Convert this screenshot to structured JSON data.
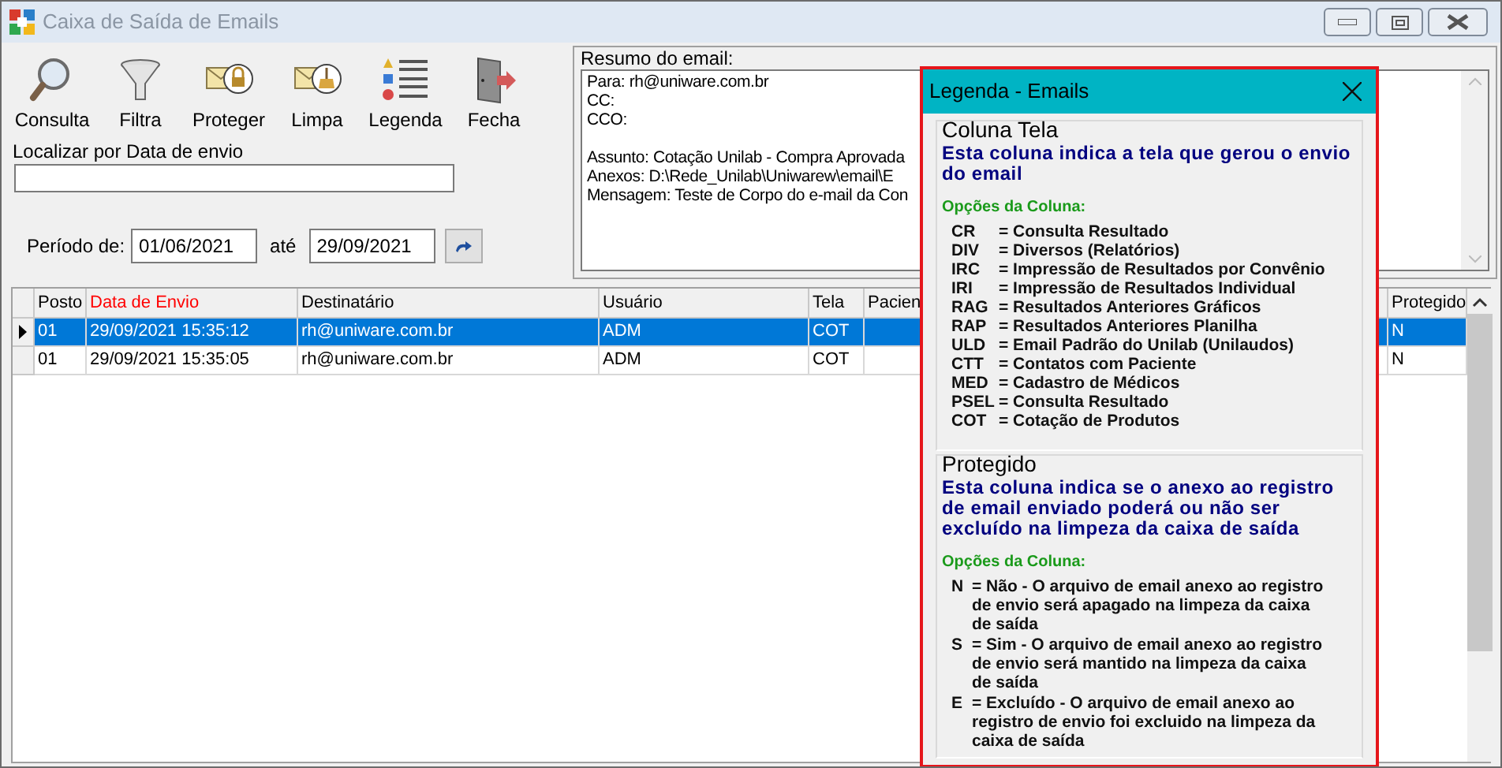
{
  "window": {
    "title": "Caixa de Saída de Emails"
  },
  "toolbar": [
    {
      "kind": "search",
      "label": "Consulta"
    },
    {
      "kind": "filter",
      "label": "Filtra"
    },
    {
      "kind": "lock",
      "label": "Proteger"
    },
    {
      "kind": "broom",
      "label": "Limpa"
    },
    {
      "kind": "list",
      "label": "Legenda"
    },
    {
      "kind": "door",
      "label": "Fecha"
    }
  ],
  "search": {
    "label": "Localizar por Data de envio"
  },
  "period": {
    "label": "Período de:",
    "from": "01/06/2021",
    "to_label": "até",
    "to": "29/09/2021"
  },
  "summary": {
    "label": "Resumo do email:",
    "lines": [
      {
        "text": "Para: rh@uniware.com.br",
        "blank_before": false
      },
      {
        "text": "CC:",
        "blank_before": false
      },
      {
        "text": "CCO:",
        "blank_before": false
      },
      {
        "text": "Assunto: Cotação Unilab - Compra Aprovada",
        "blank_before": true
      },
      {
        "text": "Anexos: D:\\Rede_Unilab\\Uniwarew\\email\\E",
        "blank_before": false
      },
      {
        "text": "Mensagem: Teste de Corpo do e-mail da Con",
        "blank_before": false
      }
    ]
  },
  "table": {
    "columns": [
      {
        "label": "Posto",
        "highlighted": false
      },
      {
        "label": "Data de Envio",
        "highlighted": true
      },
      {
        "label": "Destinatário",
        "highlighted": false
      },
      {
        "label": "Usuário",
        "highlighted": false
      },
      {
        "label": "Tela",
        "highlighted": false
      },
      {
        "label": "Pacien",
        "highlighted": false
      },
      {
        "label": "Protegido",
        "highlighted": false
      }
    ],
    "rows": [
      {
        "selected": true,
        "cells": [
          "01",
          "29/09/2021 15:35:12",
          "rh@uniware.com.br",
          "ADM",
          "COT",
          "",
          "N"
        ]
      },
      {
        "selected": false,
        "cells": [
          "01",
          "29/09/2021 15:35:05",
          "rh@uniware.com.br",
          "ADM",
          "COT",
          "",
          "N"
        ]
      }
    ]
  },
  "legend": {
    "title": "Legenda - Emails",
    "sections": [
      {
        "heading": "Coluna Tela",
        "description": "Esta coluna indica a tela que gerou o envio do email",
        "options_label": "Opções da Coluna:",
        "options": [
          {
            "code": "CR",
            "text": "= Consulta Resultado"
          },
          {
            "code": "DIV",
            "text": "= Diversos (Relatórios)"
          },
          {
            "code": "IRC",
            "text": "= Impressão de Resultados por Convênio"
          },
          {
            "code": "IRI",
            "text": "= Impressão de Resultados Individual"
          },
          {
            "code": "RAG",
            "text": "= Resultados Anteriores Gráficos"
          },
          {
            "code": "RAP",
            "text": "= Resultados Anteriores Planilha"
          },
          {
            "code": "ULD",
            "text": "= Email Padrão do Unilab (Unilaudos)"
          },
          {
            "code": "CTT",
            "text": "= Contatos com Paciente"
          },
          {
            "code": "MED",
            "text": "= Cadastro de Médicos"
          },
          {
            "code": "PSEL",
            "text": "= Consulta Resultado"
          },
          {
            "code": "COT",
            "text": "= Cotação de Produtos"
          }
        ]
      },
      {
        "heading": "Protegido",
        "description": "Esta coluna indica se o anexo ao registro de email enviado poderá ou não ser excluído na limpeza da caixa de saída",
        "options_label": "Opções da Coluna:",
        "options": [
          {
            "code": "N",
            "text": "= Não - O arquivo de email anexo ao registro de envio será apagado na limpeza da caixa de saída"
          },
          {
            "code": "S",
            "text": "= Sim - O arquivo de email anexo ao registro de envio será mantido na limpeza da caixa de saída"
          },
          {
            "code": "E",
            "text": "= Excluído - O arquivo de email anexo ao registro de envio foi excluido na limpeza da caixa de saída"
          }
        ]
      }
    ]
  }
}
